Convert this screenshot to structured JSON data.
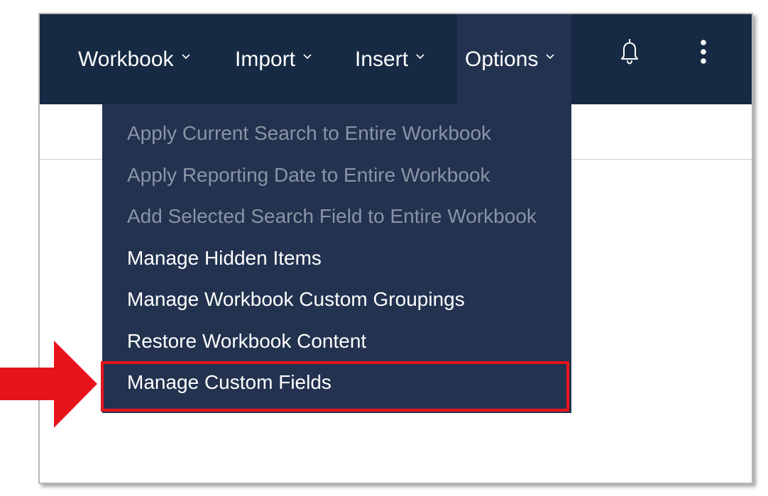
{
  "nav": {
    "items": [
      {
        "label": "Workbook",
        "icon": "chevron-down-icon"
      },
      {
        "label": "Import",
        "icon": "chevron-down-icon"
      },
      {
        "label": "Insert",
        "icon": "chevron-down-icon"
      },
      {
        "label": "Options",
        "icon": "chevron-down-icon",
        "active": true
      }
    ],
    "notification_icon": "bell-icon",
    "more_icon": "more-vertical-icon"
  },
  "options_menu": {
    "items": [
      {
        "label": "Apply Current Search to Entire Workbook",
        "enabled": false
      },
      {
        "label": "Apply Reporting Date to Entire Workbook",
        "enabled": false
      },
      {
        "label": "Add Selected Search Field to Entire Workbook",
        "enabled": false
      },
      {
        "label": "Manage Hidden Items",
        "enabled": true
      },
      {
        "label": "Manage Workbook Custom Groupings",
        "enabled": true
      },
      {
        "label": "Restore Workbook Content",
        "enabled": true
      },
      {
        "label": "Manage Custom Fields",
        "enabled": true,
        "highlighted": true
      }
    ]
  },
  "annotation": {
    "arrow_icon": "arrow-right-icon",
    "highlight_color": "#e8141b"
  },
  "colors": {
    "topbar": "#162a43",
    "menu_bg": "#22324f",
    "disabled_text": "#8b94a6",
    "text": "#ffffff"
  }
}
